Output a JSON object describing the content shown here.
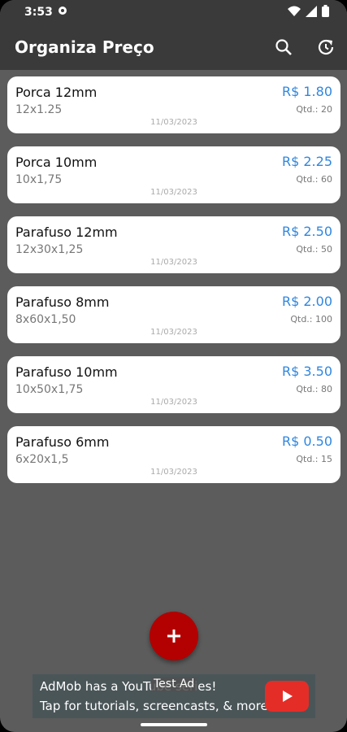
{
  "status_bar": {
    "time": "3:53",
    "icons": [
      "gear-icon",
      "wifi-icon",
      "signal-icon",
      "battery-icon"
    ]
  },
  "app_bar": {
    "title": "Organiza Preço",
    "actions": [
      "search-icon",
      "history-icon"
    ],
    "background": "#3a3a3a"
  },
  "items": [
    {
      "name": "Porca 12mm",
      "spec": "12x1.25",
      "price": "R$ 1.80",
      "qty": "Qtd.: 20",
      "date": "11/03/2023"
    },
    {
      "name": "Porca 10mm",
      "spec": "10x1,75",
      "price": "R$ 2.25",
      "qty": "Qtd.: 60",
      "date": "11/03/2023"
    },
    {
      "name": "Parafuso 12mm",
      "spec": "12x30x1,25",
      "price": "R$ 2.50",
      "qty": "Qtd.: 50",
      "date": "11/03/2023"
    },
    {
      "name": "Parafuso 8mm",
      "spec": "8x60x1,50",
      "price": "R$ 2.00",
      "qty": "Qtd.: 100",
      "date": "11/03/2023"
    },
    {
      "name": "Parafuso 10mm",
      "spec": "10x50x1,75",
      "price": "R$ 3.50",
      "qty": "Qtd.: 80",
      "date": "11/03/2023"
    },
    {
      "name": "Parafuso 6mm",
      "spec": "6x20x1,5",
      "price": "R$ 0.50",
      "qty": "Qtd.: 15",
      "date": "11/03/2023"
    }
  ],
  "fab": {
    "label": "+",
    "color": "#b30000"
  },
  "ad": {
    "line1": "AdMob has a YouTube series!",
    "line2": "Tap for tutorials, screencasts, & more.",
    "badge": "Test Ad",
    "icon": "youtube-icon"
  },
  "colors": {
    "price": "#2f86e0",
    "background": "#5c5c5c"
  }
}
